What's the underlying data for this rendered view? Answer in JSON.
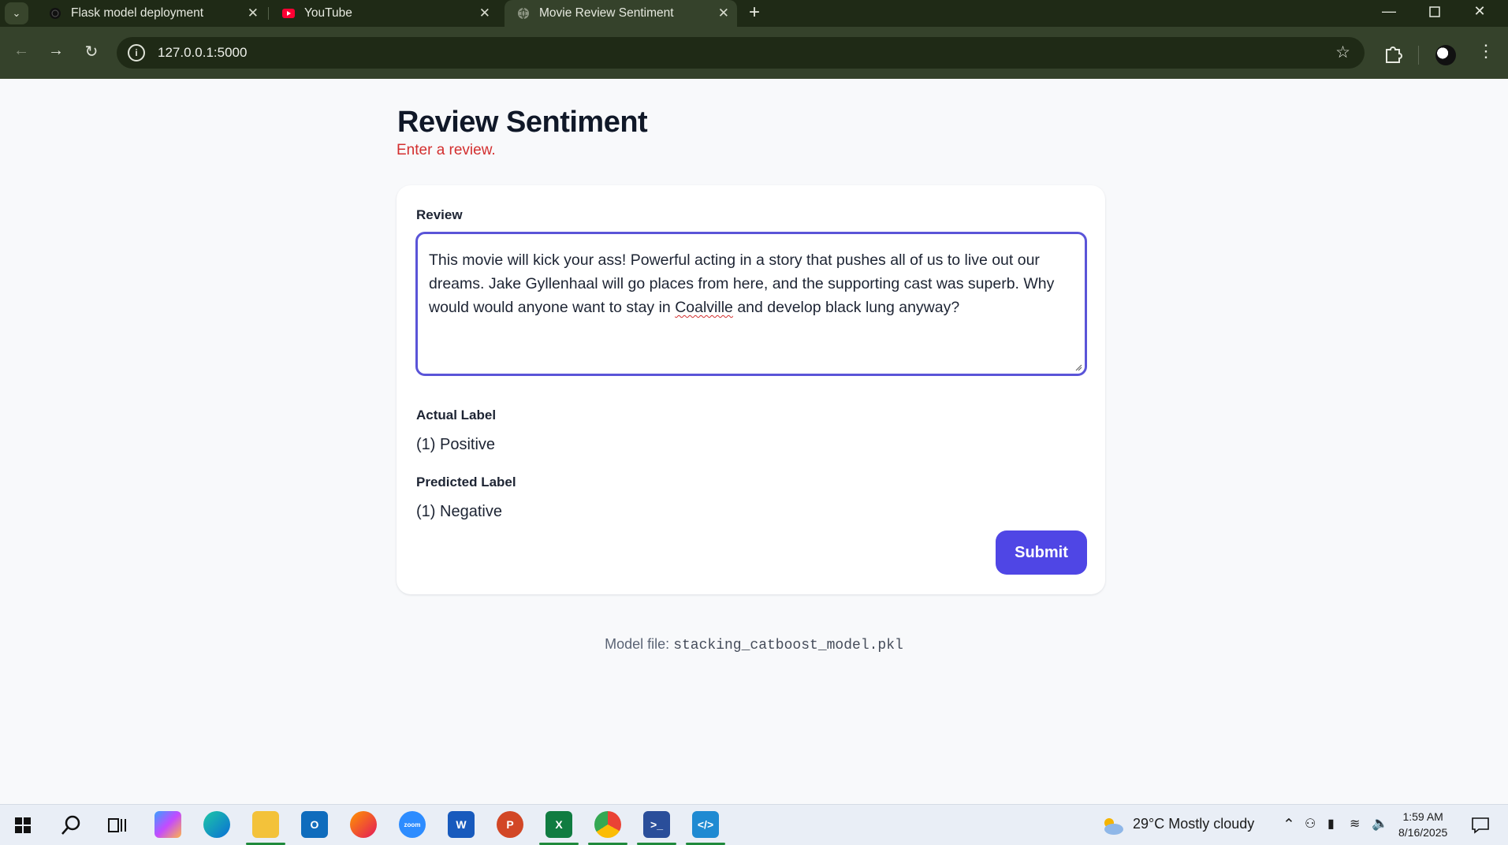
{
  "browser": {
    "tabs": [
      {
        "title": "Flask model deployment",
        "icon": "globe-dark-icon",
        "active": false
      },
      {
        "title": "YouTube",
        "icon": "youtube-icon",
        "active": false
      },
      {
        "title": "Movie Review Sentiment",
        "icon": "globe-icon",
        "active": true
      }
    ],
    "url": "127.0.0.1:5000",
    "accent": "#35422b"
  },
  "page": {
    "title": "Review Sentiment",
    "subtitle": "Enter a review.",
    "review_label": "Review",
    "review_text_before": "This movie will kick your ass! Powerful acting in a story that pushes all of us to live out our dreams. Jake Gyllenhaal will go places from here, and the supporting cast was superb. Why would would anyone want to stay in ",
    "review_text_misspelled": "Coalville",
    "review_text_after": " and develop black lung anyway?",
    "actual_label_title": "Actual Label",
    "actual_label_value": "(1) Positive",
    "predicted_label_title": "Predicted Label",
    "predicted_label_value": "(1) Negative",
    "submit_label": "Submit",
    "footer_prefix": "Model file: ",
    "footer_model_file": "stacking_catboost_model.pkl",
    "button_color": "#4f46e5",
    "subtitle_color": "#d32f2f"
  },
  "taskbar": {
    "apps": [
      "windows-start-icon",
      "search-icon",
      "task-view-icon",
      "copilot-icon",
      "edge-icon",
      "file-explorer-icon",
      "outlook-icon",
      "firefox-icon",
      "zoom-icon",
      "word-icon",
      "powerpoint-icon",
      "excel-icon",
      "chrome-icon",
      "powershell-icon",
      "vscode-icon"
    ],
    "weather": "29°C  Mostly cloudy",
    "time": "1:59 AM",
    "date": "8/16/2025"
  }
}
